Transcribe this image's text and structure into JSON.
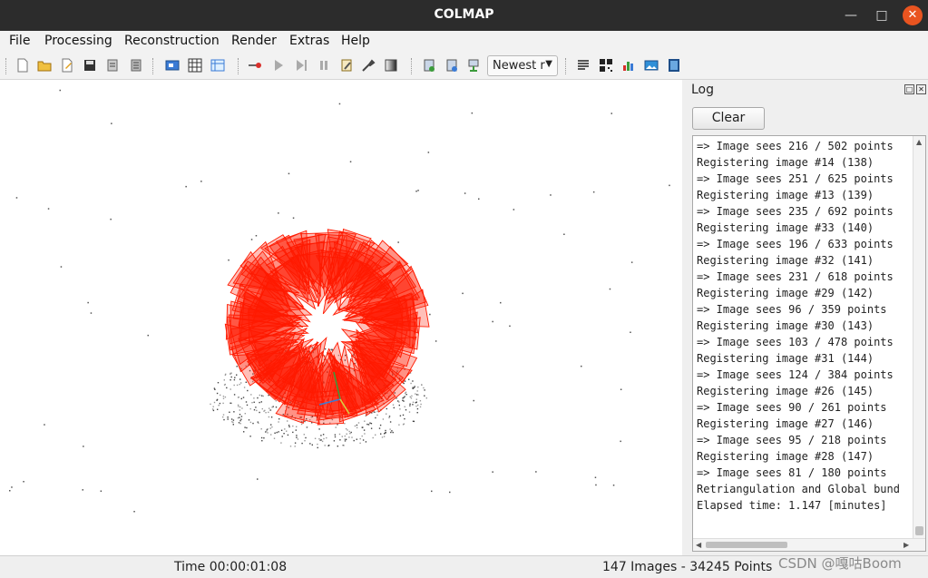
{
  "window": {
    "title": "COLMAP"
  },
  "menu": [
    "File",
    "Processing",
    "Reconstruction",
    "Render",
    "Extras",
    "Help"
  ],
  "toolbar": {
    "combo_value": "Newest r"
  },
  "log": {
    "title": "Log",
    "clear_label": "Clear",
    "lines": [
      "=> Image sees 216 / 502 points",
      "Registering image #14 (138)",
      "=> Image sees 251 / 625 points",
      "Registering image #13 (139)",
      "=> Image sees 235 / 692 points",
      "Registering image #33 (140)",
      "=> Image sees 196 / 633 points",
      "Registering image #32 (141)",
      "=> Image sees 231 / 618 points",
      "Registering image #29 (142)",
      "=> Image sees 96 / 359 points",
      "Registering image #30 (143)",
      "=> Image sees 103 / 478 points",
      "Registering image #31 (144)",
      "=> Image sees 124 / 384 points",
      "Registering image #26 (145)",
      "=> Image sees 90 / 261 points",
      "Registering image #27 (146)",
      "=> Image sees 95 / 218 points",
      "Registering image #28 (147)",
      "=> Image sees 81 / 180 points",
      "Retriangulation and Global bund",
      "Elapsed time: 1.147 [minutes]"
    ]
  },
  "status": {
    "time": "Time 00:00:01:08",
    "counts": "147 Images - 34245 Points"
  },
  "watermark": "CSDN @嘎咕Boom",
  "colors": {
    "camera_frustum": "#ff1a00",
    "titlebar": "#2c2c2c",
    "close_button": "#e95420"
  }
}
